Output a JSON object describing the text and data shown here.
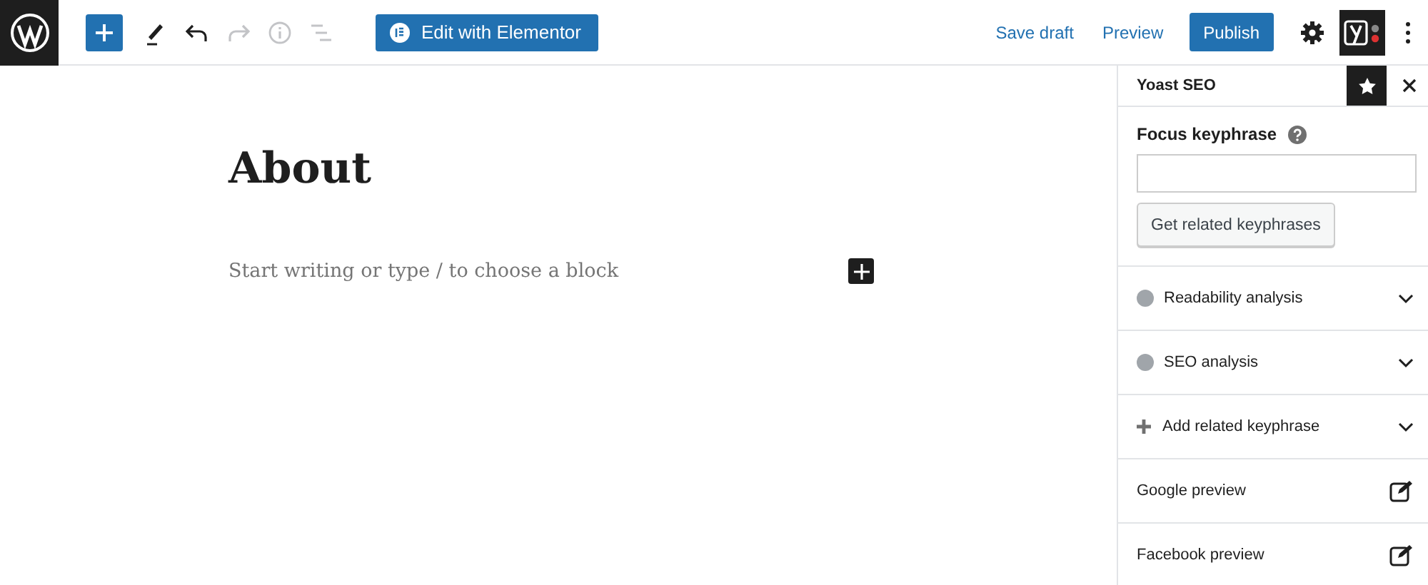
{
  "toolbar": {
    "tools": [
      {
        "kind": "add"
      },
      {
        "kind": "pen",
        "disabled": false
      },
      {
        "kind": "undo",
        "disabled": false
      },
      {
        "kind": "redo",
        "disabled": true
      },
      {
        "kind": "info",
        "disabled": true
      },
      {
        "kind": "outline",
        "disabled": true
      }
    ],
    "elementor_button": "Edit with Elementor",
    "save_draft": "Save draft",
    "preview": "Preview",
    "publish": "Publish",
    "yoast_active": true
  },
  "editor": {
    "title": "About",
    "placeholder": "Start writing or type / to choose a block"
  },
  "sidebar": {
    "title": "Yoast SEO",
    "focus_label": "Focus keyphrase",
    "related_button": "Get related keyphrases",
    "rows": [
      {
        "kind": "dot",
        "label": "Readability analysis",
        "color": "#a0a5aa"
      },
      {
        "kind": "dot",
        "label": "SEO analysis",
        "color": "#a0a5aa"
      },
      {
        "kind": "plus",
        "label": "Add related keyphrase"
      },
      {
        "kind": "edit",
        "label": "Google preview"
      },
      {
        "kind": "edit",
        "label": "Facebook preview"
      }
    ]
  }
}
